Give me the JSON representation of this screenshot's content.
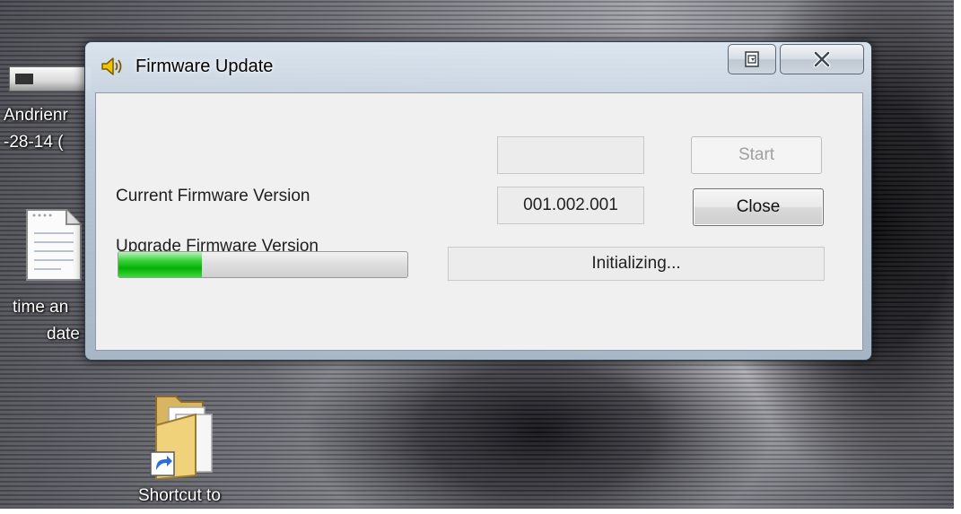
{
  "desktop": {
    "icon1_label_line1": "Andrienr",
    "icon1_label_line2": "-28-14 (",
    "icon2_label_line1": "time an",
    "icon2_label_line2": "date",
    "icon3_label": "Shortcut to"
  },
  "window": {
    "title": "Firmware Update",
    "title_icon": "speaker-icon",
    "current_version_label": "Current Firmware Version",
    "current_version_value": "",
    "upgrade_version_label": "Upgrade Firmware Version",
    "upgrade_version_value": "001.002.001",
    "start_label": "Start",
    "close_label": "Close",
    "status_text": "Initializing...",
    "progress_fraction": 0.29
  },
  "colors": {
    "progress": "#06b006",
    "disabled_text": "#a0a0a0"
  }
}
